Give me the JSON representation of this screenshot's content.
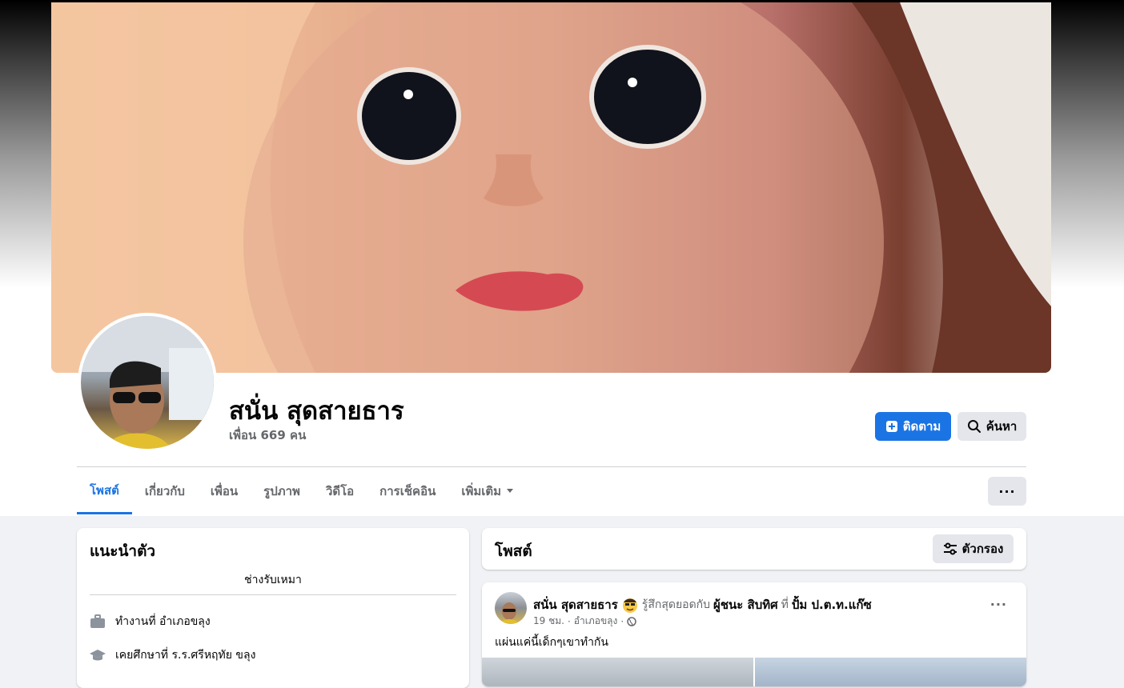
{
  "profile": {
    "name": "สนั่น สุดสายธาร",
    "friends": "เพื่อน 669 คน"
  },
  "actions": {
    "follow_label": "ติดตาม",
    "search_label": "ค้นหา",
    "more_label": "···"
  },
  "tabs": [
    {
      "label": "โพสต์",
      "active": true
    },
    {
      "label": "เกี่ยวกับ"
    },
    {
      "label": "เพื่อน"
    },
    {
      "label": "รูปภาพ"
    },
    {
      "label": "วิดีโอ"
    },
    {
      "label": "การเช็คอิน"
    },
    {
      "label": "เพิ่มเติม"
    }
  ],
  "intro": {
    "title": "แนะนำตัว",
    "bio": "ช่างรับเหมา",
    "work": "ทำงานที่ อำเภอขลุง",
    "education": "เคยศึกษาที่ ร.ร.ศรีหฤทัย ขลุง"
  },
  "posts_section": {
    "title": "โพสต์",
    "filter_label": "ตัวกรอง"
  },
  "post": {
    "author": "สนั่น สุดสายธาร",
    "feeling": "รู้สึกสุดยอดกับ",
    "tagged": "ผู้ชนะ สิบทิศ",
    "at": "ที่",
    "place": "ปั้ม ป.ต.ท.แก๊ซ",
    "time": "19 ชม.",
    "location": "อำเภอขลุง",
    "dot": "·",
    "text": "แผ่นแค่นี้เด็กๆเขาทำกัน",
    "menu": "···"
  },
  "colors": {
    "accent": "#1b74e4",
    "page_bg": "#f0f2f5",
    "button_gray": "#e4e6eb",
    "muted_text": "#65676b"
  }
}
